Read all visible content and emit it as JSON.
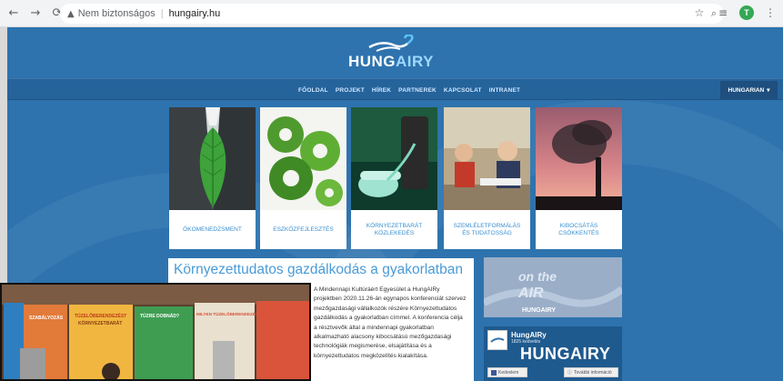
{
  "browser": {
    "back_icon": "arrow-left-icon",
    "forward_icon": "arrow-right-icon",
    "reload_icon": "reload-icon",
    "security_label": "Nem biztonságos",
    "separator": "|",
    "url": "hungairy.hu",
    "profile_initial": "T"
  },
  "site": {
    "logo_text_a": "HUNG",
    "logo_text_b": "AIRY",
    "menu": [
      "FŐOLDAL",
      "PROJEKT",
      "HÍREK",
      "PARTNEREK",
      "KAPCSOLAT",
      "INTRANET"
    ],
    "language": "HUNGARIAN"
  },
  "tiles": [
    {
      "label": "ÖKOMENEDZSMENT"
    },
    {
      "label": "ESZKÖZFEJLESZTÉS"
    },
    {
      "label": "KÖRNYEZETBARÁT KÖZLEKEDÉS"
    },
    {
      "label": "SZEMLÉLETFORMÁLÁS ÉS TUDATOSSÁG"
    },
    {
      "label": "KIBOCSÁTÁS CSÖKKENTÉS"
    }
  ],
  "article": {
    "title": "Környezettudatos gazdálkodás a gyakorlatban",
    "body": "A Mindennapi Kultúráért Egyesület a HungAIRy projektben 2020.11.26-án egynapos konferenciát szervez mezőgazdasági vállalkozók részére Környezettudatos gazdálkodás a gyakorlatban címmel. A konferencia célja a résztvevők által a mindennapi gyakorlatban alkalmazható alacsony kibocsátású mezőgazdasági technológiák megismerése, elsajátítása és a környezettudatos megközelítés kialakítása."
  },
  "sidebar": {
    "on_air_line1": "on the",
    "on_air_line2": "AIR",
    "on_air_brand": "HUNGAIRY",
    "fb_name": "HungAIRy",
    "fb_likes": "1825 kedvelés",
    "fb_big": "HUNGAIRY",
    "fb_like": "Kedvelem",
    "fb_more": "További információ"
  },
  "overlay": {
    "poster1_title": "MILYEN TÜZELŐBERENDEZÉST VÁLASSZAK?",
    "poster2_title": "TÜZELŐBERENDEZÉST",
    "poster3_title": "TÜZRE DOBNÁD?",
    "poster4_title": "KÖRNYEZETBARÁT",
    "poster5_title": "SZABÁLYOZÁS"
  }
}
